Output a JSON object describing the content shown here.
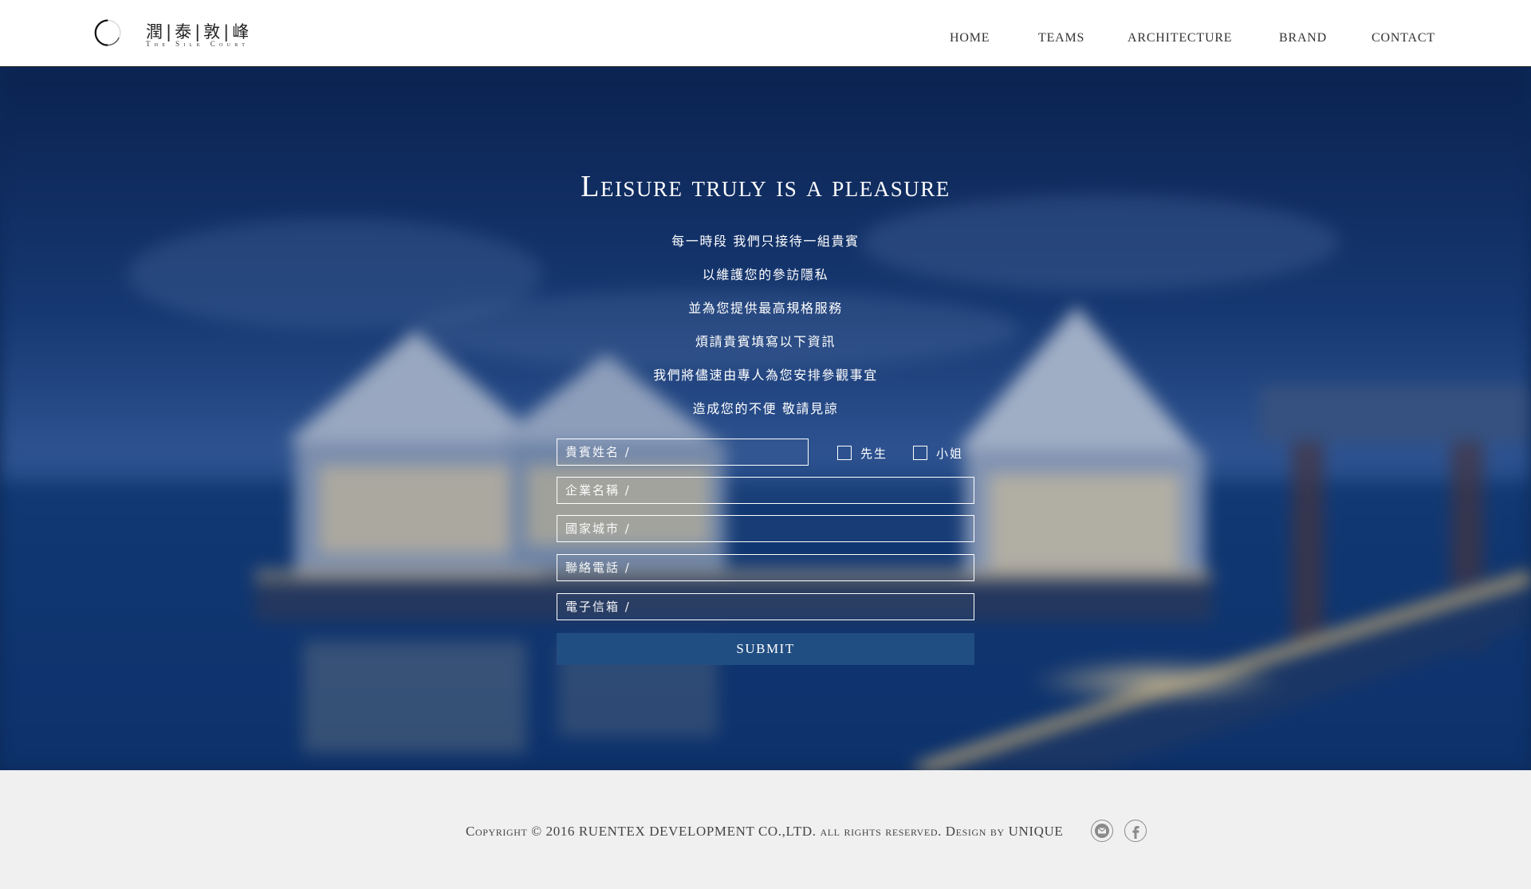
{
  "brand": {
    "name_cn": "潤|泰|敦|峰",
    "name_en": "The Silk Court"
  },
  "nav": {
    "items": [
      "HOME",
      "TEAMS",
      "ARCHITECTURE",
      "BRAND",
      "CONTACT"
    ]
  },
  "hero": {
    "title": "Leisure truly is a pleasure",
    "intro": [
      "每一時段 我們只接待一組貴賓",
      "以維護您的參訪隱私",
      "並為您提供最高規格服務",
      "煩請貴賓填寫以下資訊",
      "我們將儘速由專人為您安排參觀事宜",
      "造成您的不便 敬請見諒"
    ]
  },
  "form": {
    "name_placeholder": "貴賓姓名 /",
    "title_options": [
      "先生",
      "小姐"
    ],
    "company_placeholder": "企業名稱 /",
    "city_placeholder": "國家城市 /",
    "phone_placeholder": "聯絡電話 /",
    "email_placeholder": "電子信箱 /",
    "submit_label": "SUBMIT"
  },
  "footer": {
    "copyright": "Copyright © 2016 RUENTEX DEVELOPMENT CO.,LTD. all rights reserved. Design by UNIQUE",
    "social": [
      "mail-icon",
      "facebook-icon"
    ]
  },
  "colors": {
    "accent": "#214e82",
    "hero_base": "#0c2a58",
    "footer_bg": "#f0f0f0"
  }
}
